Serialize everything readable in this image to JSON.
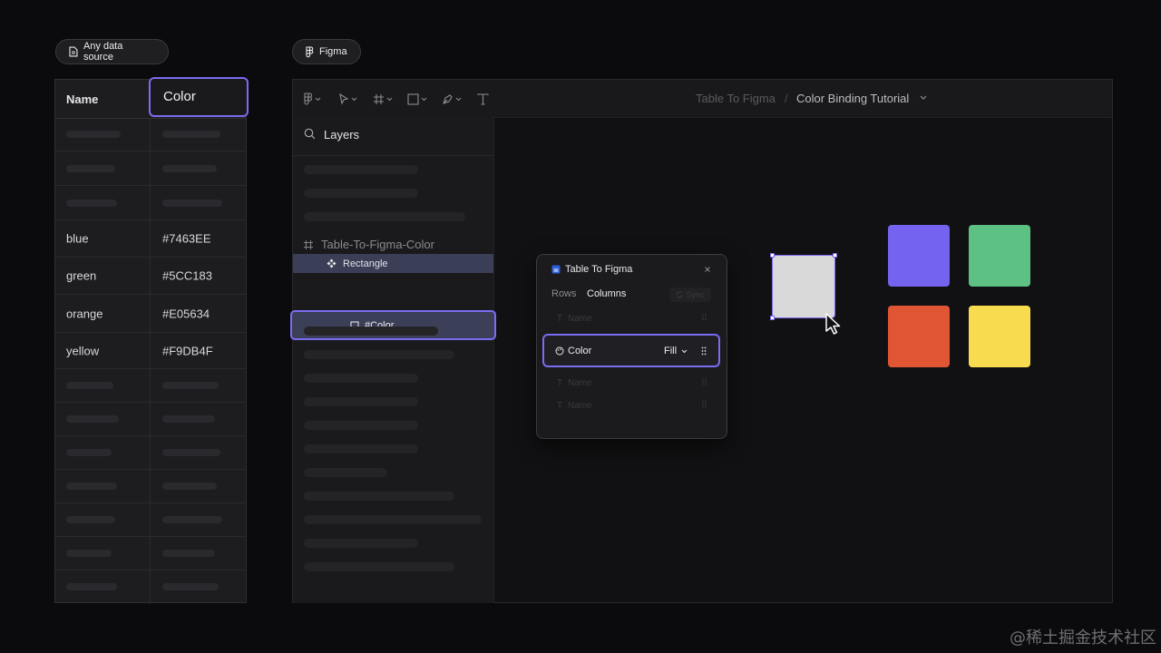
{
  "source_pill": {
    "label": "Any data source"
  },
  "figma_pill": {
    "label": "Figma"
  },
  "table": {
    "headers": [
      "Name",
      "Color"
    ],
    "rows": [
      {
        "name": "blue",
        "color": "#7463EE"
      },
      {
        "name": "green",
        "color": "#5CC183"
      },
      {
        "name": "orange",
        "color": "#E05634"
      },
      {
        "name": "yellow",
        "color": "#F9DB4F"
      }
    ]
  },
  "figma": {
    "breadcrumb": {
      "project": "Table To Figma",
      "separator": "/",
      "file": "Color Binding Tutorial"
    },
    "layers": {
      "title": "Layers",
      "frame": "Table-To-Figma-Color",
      "component": "Rectangle",
      "child": "#Color"
    },
    "plugin": {
      "title": "Table To Figma",
      "tabs": [
        "Rows",
        "Columns"
      ],
      "sync": "Sync",
      "placeholder_row": "Name",
      "column_row": {
        "label": "Color",
        "property": "Fill"
      }
    },
    "swatches": [
      "#7463EE",
      "#5CC183",
      "#E05634",
      "#F9DB4F"
    ],
    "placeholder_fill": "#D9D9D9"
  },
  "colors": {
    "accent": "#7B6CF0",
    "background": "#0B0B0D"
  },
  "watermark": "@稀土掘金技术社区"
}
